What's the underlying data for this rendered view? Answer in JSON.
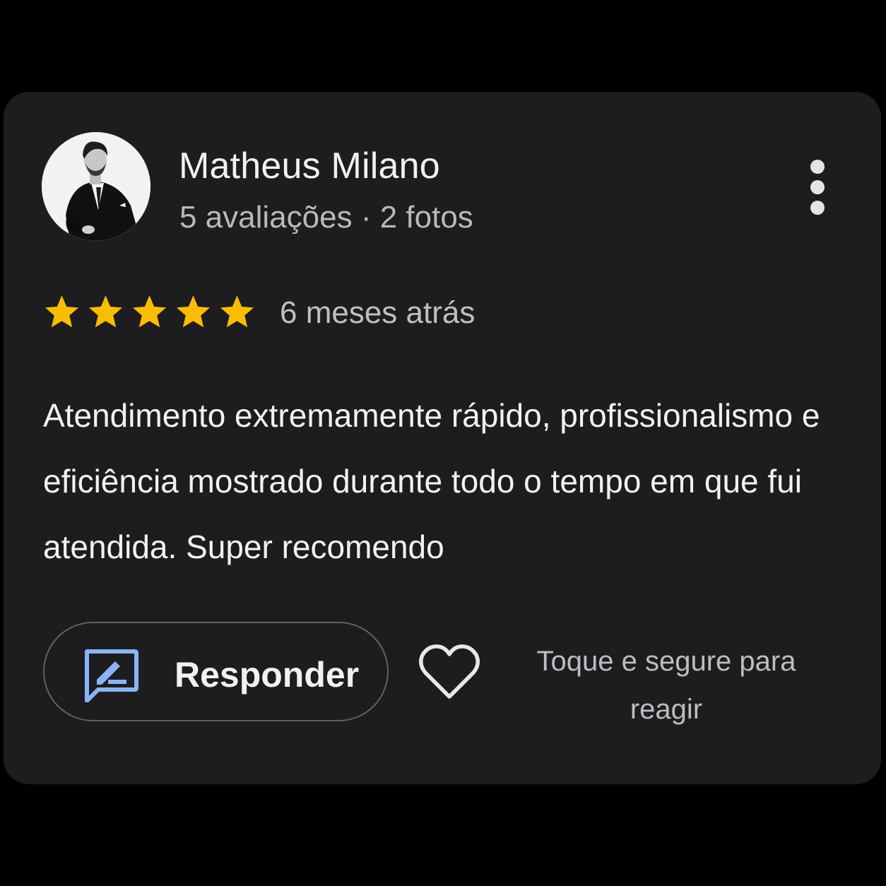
{
  "review": {
    "author": {
      "name": "Matheus Milano",
      "stats": "5 avaliações · 2 fotos",
      "avatar": "profile-photo-man-in-suit"
    },
    "rating": {
      "value": 5,
      "max": 5,
      "star_color": "#fbbc04"
    },
    "time_ago": "6 meses atrás",
    "text": "Atendimento extremamente rápido, profissionalismo e eficiência mostrado durante todo o tempo em que fui atendida. Super recomendo"
  },
  "actions": {
    "more_icon": "vertical-ellipsis-icon",
    "respond": {
      "label": "Responder",
      "icon": "reply-edit-icon",
      "icon_color": "#8ab4f8"
    },
    "react": {
      "icon": "heart-outline-icon",
      "hint": "Toque e segure para reagir"
    }
  },
  "theme": {
    "card_background": "#1d1d20",
    "text_primary": "#f1f1f1",
    "text_secondary": "#b9b9bd"
  }
}
